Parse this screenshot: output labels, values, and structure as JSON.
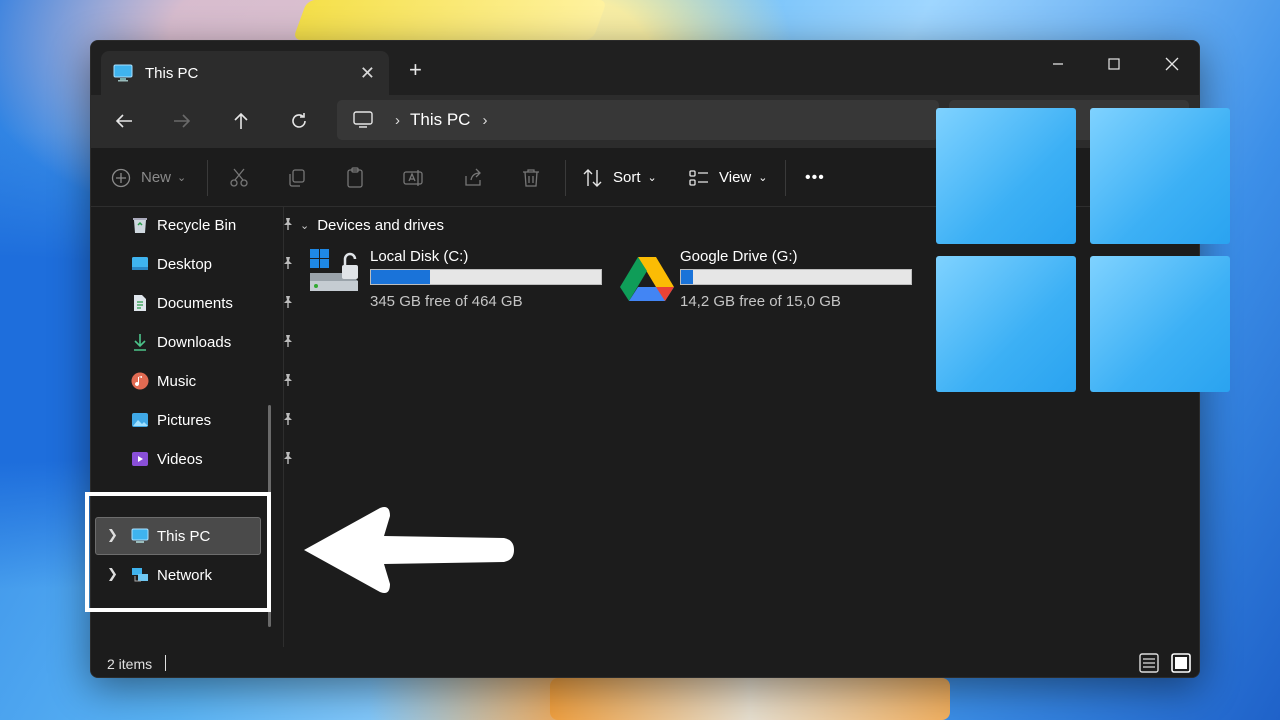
{
  "window": {
    "tab_title": "This PC",
    "new_tab": "+"
  },
  "address": {
    "path": "This PC"
  },
  "toolbar": {
    "new_label": "New",
    "sort_label": "Sort",
    "view_label": "View",
    "more_label": "•••"
  },
  "sidebar": {
    "items": [
      {
        "label": "Recycle Bin",
        "icon": "recycle-bin-icon"
      },
      {
        "label": "Desktop",
        "icon": "desktop-icon"
      },
      {
        "label": "Documents",
        "icon": "documents-icon"
      },
      {
        "label": "Downloads",
        "icon": "downloads-icon"
      },
      {
        "label": "Music",
        "icon": "music-icon"
      },
      {
        "label": "Pictures",
        "icon": "pictures-icon"
      },
      {
        "label": "Videos",
        "icon": "videos-icon"
      }
    ],
    "this_pc": "This PC",
    "network": "Network"
  },
  "content": {
    "group_header": "Devices and drives",
    "drives": [
      {
        "name": "Local Disk (C:)",
        "free": "345 GB free of 464 GB",
        "used_fraction": 0.256
      },
      {
        "name": "Google Drive (G:)",
        "free": "14,2 GB free of 15,0 GB",
        "used_fraction": 0.053
      }
    ]
  },
  "status": {
    "items_text": "2 items"
  },
  "colors": {
    "accent": "#1a73d9",
    "window_bg": "#1c1c1c",
    "logo": "#3cb0f5"
  }
}
